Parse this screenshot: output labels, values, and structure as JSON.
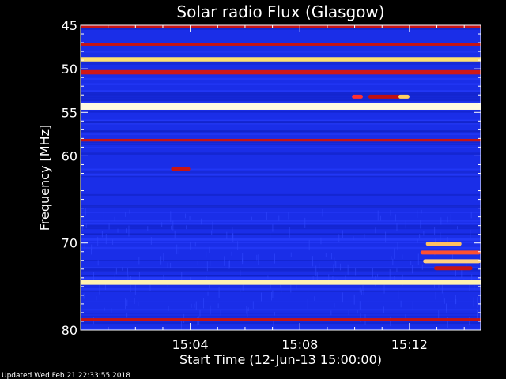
{
  "chart_data": {
    "type": "heatmap",
    "title": "Solar radio Flux (Glasgow)",
    "ylabel": "Frequency [MHz]",
    "xlabel": "Start Time (12-Jun-13 15:00:00)",
    "ylim": [
      45,
      80
    ],
    "y_inverted": true,
    "y_ticks": [
      45,
      50,
      55,
      60,
      70,
      80
    ],
    "x_unit": "minutes after 15:00",
    "xlim": [
      0,
      14.6
    ],
    "x_ticks": [
      {
        "value": 4,
        "label": "15:04"
      },
      {
        "value": 8,
        "label": "15:08"
      },
      {
        "value": 12,
        "label": "15:12"
      }
    ],
    "background_color": "#1a2ee8",
    "persistent_bands": [
      {
        "freq": 45.2,
        "width": 0.3,
        "color": "#c81414"
      },
      {
        "freq": 47.2,
        "width": 0.3,
        "color": "#c81414"
      },
      {
        "freq": 48.9,
        "width": 0.5,
        "color": "#ffe070"
      },
      {
        "freq": 50.4,
        "width": 0.5,
        "color": "#d01818"
      },
      {
        "freq": 54.3,
        "width": 0.8,
        "color": "#fffbe0"
      },
      {
        "freq": 58.2,
        "width": 0.3,
        "color": "#c81414"
      },
      {
        "freq": 74.5,
        "width": 0.6,
        "color": "#fff2b0"
      },
      {
        "freq": 78.8,
        "width": 0.3,
        "color": "#c81414"
      }
    ],
    "bursts": [
      {
        "t_start": 9.9,
        "t_end": 10.3,
        "freq": 53.2,
        "color": "#ff3030"
      },
      {
        "t_start": 10.5,
        "t_end": 11.7,
        "freq": 53.2,
        "color": "#c01010"
      },
      {
        "t_start": 11.6,
        "t_end": 12.0,
        "freq": 53.2,
        "color": "#ffd060"
      },
      {
        "t_start": 3.3,
        "t_end": 4.0,
        "freq": 61.5,
        "color": "#c81414"
      },
      {
        "t_start": 12.6,
        "t_end": 13.9,
        "freq": 70.1,
        "color": "#ffc060"
      },
      {
        "t_start": 12.4,
        "t_end": 14.6,
        "freq": 71.1,
        "color": "#ff5030"
      },
      {
        "t_start": 12.5,
        "t_end": 14.6,
        "freq": 72.1,
        "color": "#ffd080"
      },
      {
        "t_start": 12.9,
        "t_end": 14.3,
        "freq": 72.9,
        "color": "#c81414"
      }
    ],
    "footer_text": "Updated Wed Feb 21 22:33:55 2018"
  }
}
